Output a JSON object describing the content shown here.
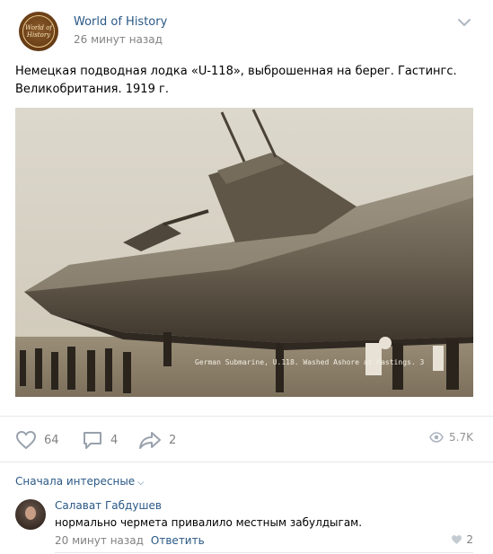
{
  "post": {
    "author": "World of History",
    "avatar_logo_text": "World of History",
    "time": "26 минут назад",
    "text": "Немецкая подводная лодка «U-118», выброшенная на берег. Гастингс. Великобритания. 1919 г.",
    "photo_caption": "German Submarine, U.118. Washed Ashore at Hastings. 3",
    "menu_icon": "chevron-down-icon"
  },
  "actions": {
    "likes": "64",
    "comments": "4",
    "shares": "2",
    "views": "5.7K"
  },
  "comments": {
    "sort_label": "Сначала интересные",
    "items": [
      {
        "author": "Салават Габдушев",
        "text": "нормально чермета привалило местным забулдыгам.",
        "time": "20 минут назад",
        "reply_label": "Ответить",
        "likes": "2"
      }
    ]
  },
  "colors": {
    "link": "#2a5885",
    "muted": "#828282",
    "divider": "#e7e8ec"
  }
}
